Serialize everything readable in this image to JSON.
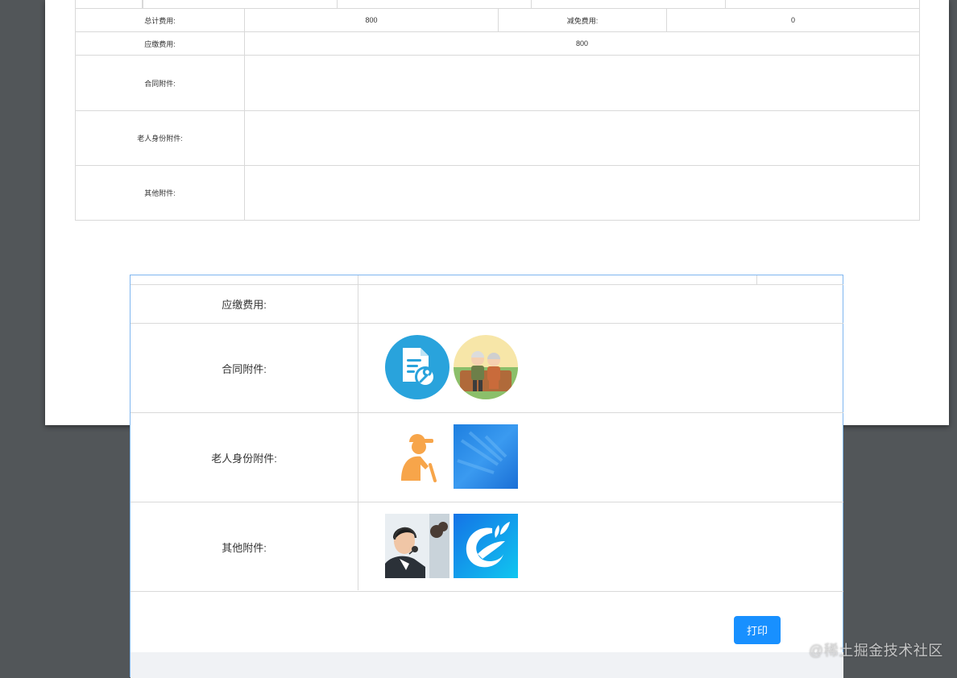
{
  "background_sheet": {
    "rows": [
      {
        "label": "总计费用:",
        "value": "800",
        "label2": "减免费用:",
        "value2": "0"
      },
      {
        "label": "应缴费用:",
        "value": "800"
      },
      {
        "label": "合同附件:"
      },
      {
        "label": "老人身份附件:"
      },
      {
        "label": "其他附件:"
      }
    ]
  },
  "dialog": {
    "rows": [
      {
        "label": "应缴费用:"
      },
      {
        "label": "合同附件:",
        "attachments": [
          "document-settings-icon-image",
          "elderly-couple-illustration-image"
        ]
      },
      {
        "label": "老人身份附件:",
        "attachments": [
          "elderly-person-icon-image",
          "blue-abstract-image"
        ]
      },
      {
        "label": "其他附件:",
        "attachments": [
          "customer-service-photo-image",
          "blue-logo-image"
        ]
      }
    ],
    "print_button_label": "打印"
  },
  "watermark": "@稀土掘金技术社区"
}
